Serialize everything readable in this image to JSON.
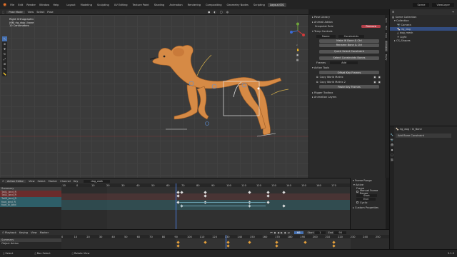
{
  "app": {
    "title": "Blender"
  },
  "menu": {
    "items": [
      "File",
      "Edit",
      "Render",
      "Window",
      "Help"
    ]
  },
  "workspaces": {
    "tabs": [
      "Layout",
      "Modeling",
      "Sculpting",
      "UV Editing",
      "Texture Paint",
      "Shading",
      "Animation",
      "Rendering",
      "Compositing",
      "Geometry Nodes",
      "Scripting",
      "Layout.001"
    ]
  },
  "scene": {
    "label": "Scene",
    "view_layer": "ViewLayer"
  },
  "viewport": {
    "mode": "Pose Mode",
    "menus": [
      "View",
      "Select",
      "Pose"
    ],
    "info_line1": "Right Orthographic",
    "info_line2": "(66) rig_dog | bone",
    "info_line3": "10 Centimeters"
  },
  "npanel": {
    "items": [
      "Pose Library",
      "Animall Addon",
      "Snapshot Rule",
      "Temp Controls",
      "Name",
      "Constraints",
      "Make IK Bone & Ctrl",
      "Rename Bone & Ctrl",
      "Quick Select Constraint",
      "Select Constraints Bones",
      "Frames",
      "Add",
      "Action Tools",
      "Offset Key Frames",
      "Copy World Matrix",
      "Copy World Matrix 2",
      "Paste Key Frames",
      "Rigger Toolbox",
      "Animation Layers"
    ],
    "remove_label": "Remove"
  },
  "sidetabs": [
    "Item",
    "Tool",
    "View",
    "Animation",
    "Rigify"
  ],
  "outliner": {
    "title": "Scene Collection",
    "rows": [
      "Scene Collection",
      "Collection",
      "Camera",
      "rig_dog",
      "dog_mesh",
      "Light",
      "CS_Shapes"
    ]
  },
  "properties": {
    "path": "rig_dog",
    "sub": "Ik_Bone",
    "label": "Add Bone Constraint"
  },
  "dope": {
    "header": [
      "Action Editor",
      "View",
      "Select",
      "Marker",
      "Channel",
      "Key"
    ],
    "action": "dog_walk",
    "channels": [
      "Summary",
      "Tail1_bnd_R",
      "Tail2_bnd_R",
      "Tail3_bnd_R",
      "foot_bnd_R",
      "foot_ik_bnd"
    ],
    "ticks": [
      "-10",
      "0",
      "10",
      "20",
      "30",
      "40",
      "50",
      "60",
      "70",
      "80",
      "90",
      "100",
      "110",
      "120",
      "130",
      "140",
      "150",
      "160",
      "170"
    ]
  },
  "dopenp": {
    "title": "Frame Range",
    "items": [
      "Active",
      "Frame",
      "Manual Frame Range",
      "Start",
      "End",
      "Cyclic",
      "Custom Properties"
    ]
  },
  "timeline": {
    "menus": [
      "Playback",
      "Keying",
      "View",
      "Marker"
    ],
    "current_frame": "66",
    "start_label": "Start",
    "start": "1",
    "end_label": "End",
    "end": "90",
    "channels": [
      "Summary",
      "Object Action"
    ],
    "ticks": [
      "0",
      "10",
      "20",
      "30",
      "40",
      "50",
      "60",
      "70",
      "80",
      "90",
      "100",
      "110",
      "120",
      "130",
      "140",
      "150",
      "160",
      "170",
      "180",
      "190",
      "200",
      "210",
      "220",
      "230",
      "240",
      "250"
    ]
  },
  "status": {
    "left": "Select",
    "mid": "Box Select",
    "right": "Rotate View",
    "version": "3.1.0"
  }
}
